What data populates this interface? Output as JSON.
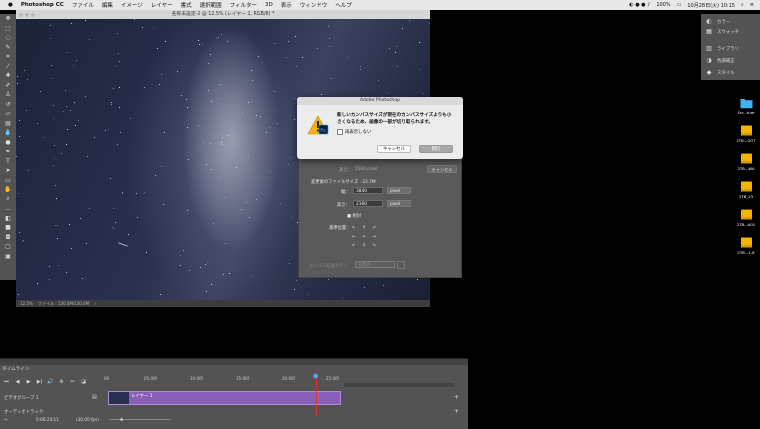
{
  "menubar": {
    "apple": "",
    "app_name": "Photoshop CC",
    "items": [
      "ファイル",
      "編集",
      "イメージ",
      "レイヤー",
      "書式",
      "選択範囲",
      "フィルター",
      "3D",
      "表示",
      "ウィンドウ",
      "ヘルプ"
    ],
    "battery": "100%",
    "clock": "10月28日(火)  10:15"
  },
  "document": {
    "title": "名称未設定-2 @ 12.5% (レイヤー 1, RGB/8) *",
    "zoom": "12.5%",
    "file_info": "ファイル : 130.0M/130.0M"
  },
  "canvas_size_dialog": {
    "height_label": "高さ：",
    "height_current": "5504 pixel",
    "cancel_label": "キャンセル",
    "new_size_label": "変更後のファイルサイズ : 23.7M",
    "width_label": "幅：",
    "width_value": "3840",
    "width_unit": "pixel",
    "height_new_label": "高さ：",
    "height_value": "2160",
    "height_unit": "pixel",
    "relative_label": "相対",
    "anchor_label": "基準位置：",
    "anchor_arrows": [
      "↖",
      "↑",
      "↗",
      "←",
      "•",
      "→",
      "↙",
      "↓",
      "↘"
    ],
    "extension_color_label": "カンバス拡張カラー：",
    "extension_color_value": "背景色"
  },
  "alert": {
    "title": "Adobe Photoshop",
    "message": "新しいカンバスサイズが現在のカンバスサイズよりも小さくなるため、画像の一部が切り取られます。",
    "checkbox_label": "再表示しない",
    "cancel_label": "キャンセル",
    "proceed_label": "続行"
  },
  "right_panel": {
    "items": [
      "カラー",
      "スウォッチ",
      "ライブラリ",
      "色調補正",
      "スタイル"
    ]
  },
  "desktop_icons": [
    {
      "label": "Scr...ture",
      "type": "folder"
    },
    {
      "label": "2TB...OOT",
      "type": "drive"
    },
    {
      "label": "2TB...WA",
      "type": "drive"
    },
    {
      "label": "2TB_23",
      "type": "drive"
    },
    {
      "label": "2TB...A01",
      "type": "drive"
    },
    {
      "label": "2TB...1-8",
      "type": "drive"
    }
  ],
  "timeline": {
    "tab_label": "タイムライン",
    "ruler_ticks": [
      "00",
      "05:00f",
      "10:00f",
      "15:00f",
      "20:00f",
      "25:00f"
    ],
    "video_group_label": "ビデオグループ 1",
    "layer_label": "レイヤー 1",
    "audio_label": "オーディオトラック",
    "timecode": "0:00:23:11",
    "fps": "(30.00 fps)"
  },
  "colors": {
    "track": "#8a5fb8",
    "playhead": "#dd3333",
    "alert_bg": "#ececec",
    "panel": "#535353"
  }
}
